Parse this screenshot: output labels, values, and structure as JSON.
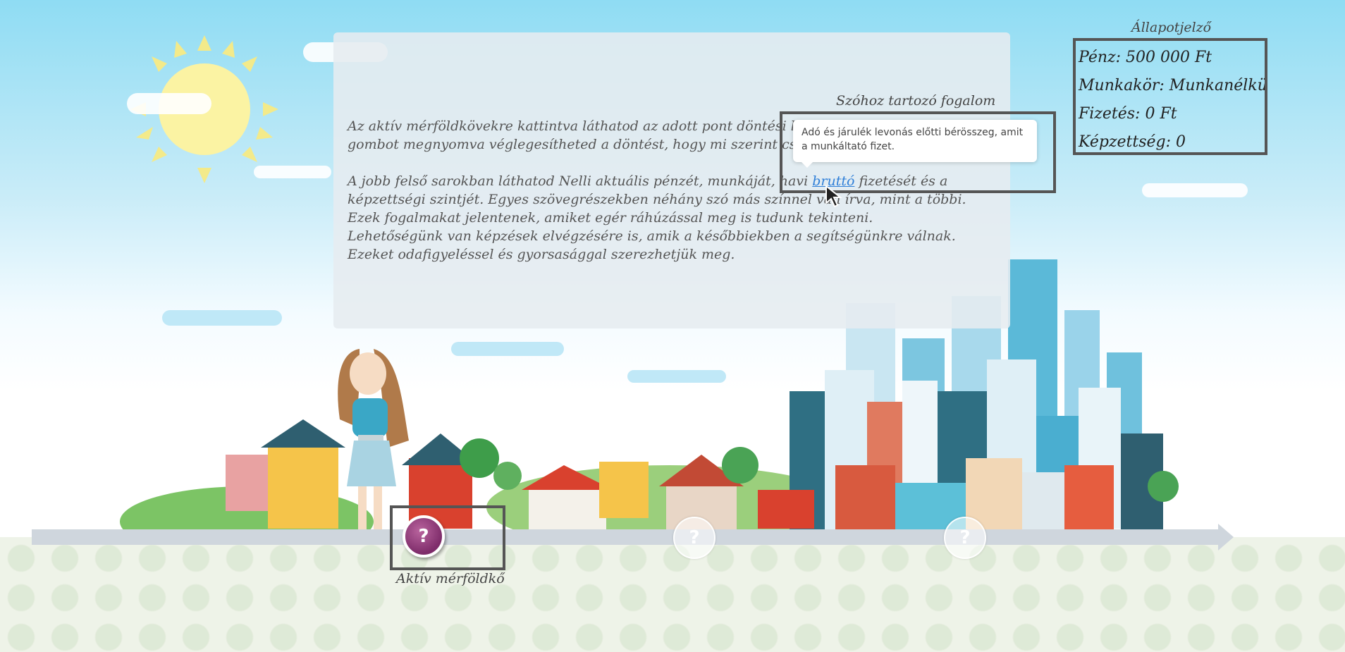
{
  "info": {
    "paragraph1": "Az aktív mérföldkövekre kattintva láthatod az adott pont döntési lehetőségeit. A döntés gombot megnyomva véglegesítheted a döntést, hogy mi szerint cselekedjen Nelli.",
    "paragraph2_before": "A jobb felső sarokban láthatod Nelli aktuális pénzét, munkáját, havi ",
    "term": "bruttó",
    "paragraph2_after": " fizetését és a képzettségi szintjét. Egyes szövegrészekben néhány szó más színnel van írva, mint a többi. Ezek fogalmakat jelentenek, amiket egér ráhúzással meg is tudunk tekinteni.",
    "paragraph3": "Lehetőségünk van képzések elvégzésére is, amik a későbbiekben a segítségünkre válnak. Ezeket odafigyeléssel és gyorsasággal szerezhetjük meg."
  },
  "tooltip": {
    "label": "Szóhoz tartozó fogalom",
    "text": "Adó és járulék levonás előtti bérösszeg, amit a munkáltató fizet."
  },
  "status": {
    "label": "Állapotjelző",
    "money": "Pénz: 500 000 Ft",
    "job": "Munkakör: Munkanélküli",
    "salary": "Fizetés: 0 Ft",
    "education": "Képzettség: 0"
  },
  "timeline": {
    "active_label": "Aktív mérföldkő",
    "milestone_symbol": "?"
  },
  "colors": {
    "term": "#2f7fd8",
    "milestone_active": "#8a3374"
  }
}
